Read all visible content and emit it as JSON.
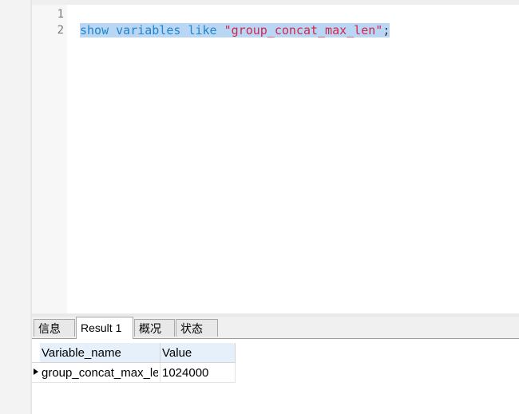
{
  "editor": {
    "line_numbers": [
      "1",
      "2"
    ],
    "lines": [
      {
        "tokens": []
      },
      {
        "tokens": [
          {
            "text": "show",
            "kind": "keyword"
          },
          {
            "text": " ",
            "kind": "space"
          },
          {
            "text": "variables",
            "kind": "keyword"
          },
          {
            "text": " ",
            "kind": "space"
          },
          {
            "text": "like",
            "kind": "keyword"
          },
          {
            "text": " ",
            "kind": "space"
          },
          {
            "text": "\"group_concat_max_len\"",
            "kind": "string"
          },
          {
            "text": ";",
            "kind": "punctuation"
          }
        ]
      }
    ],
    "selected_line": 2
  },
  "tabs": [
    {
      "label": "信息",
      "active": false
    },
    {
      "label": "Result 1",
      "active": true
    },
    {
      "label": "概况",
      "active": false
    },
    {
      "label": "状态",
      "active": false
    }
  ],
  "result": {
    "columns": [
      "Variable_name",
      "Value"
    ],
    "rows": [
      {
        "current": true,
        "cells": [
          "group_concat_max_len",
          "1024000"
        ]
      }
    ]
  },
  "colors": {
    "keyword": "#1e86c9",
    "string": "#d4264a",
    "selection": "#b9d7f5",
    "header_bg": "#e6f0fb"
  },
  "icons": {
    "row_indicator": "current-row-triangle-icon"
  }
}
